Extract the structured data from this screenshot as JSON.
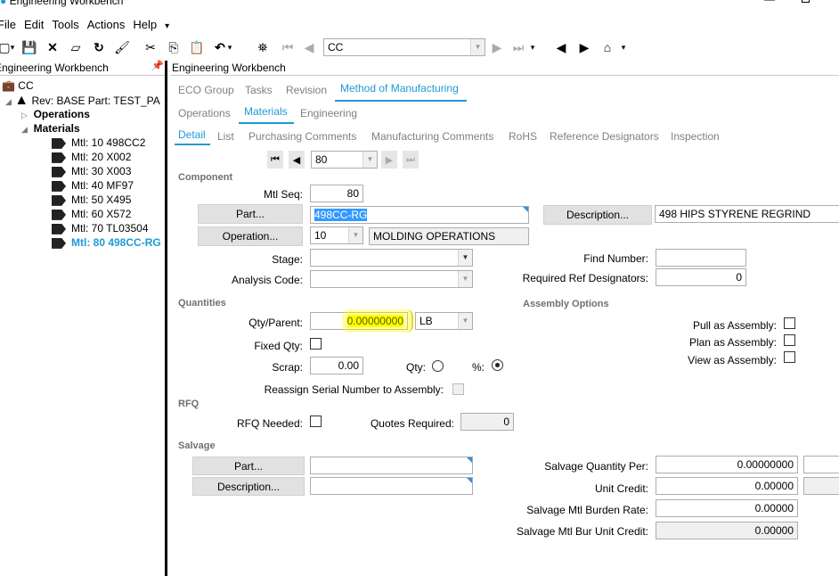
{
  "window": {
    "title": "Engineering Workbench"
  },
  "menu": [
    "File",
    "Edit",
    "Tools",
    "Actions",
    "Help"
  ],
  "toolbar": {
    "search_value": "CC"
  },
  "left": {
    "header": "Engineering Workbench",
    "root": "CC",
    "rev": "Rev: BASE Part: TEST_PA",
    "operations": "Operations",
    "materials": "Materials",
    "items": [
      "Mtl: 10 498CC2",
      "Mtl: 20 X002",
      "Mtl: 30 X003",
      "Mtl: 40 MF97",
      "Mtl: 50 X495",
      "Mtl: 60 X572",
      "Mtl: 70 TL03504",
      "Mtl: 80 498CC-RG"
    ]
  },
  "right": {
    "header": "Engineering Workbench"
  },
  "tabs1": [
    "ECO Group",
    "Tasks",
    "Revision",
    "Method of Manufacturing"
  ],
  "tabs2": [
    "Operations",
    "Materials",
    "Engineering"
  ],
  "tabs3": [
    "Detail",
    "List",
    "Purchasing Comments",
    "Manufacturing Comments",
    "RoHS",
    "Reference Designators",
    "Inspection"
  ],
  "nav_value": "80",
  "component": {
    "section": "Component",
    "mtl_seq_label": "Mtl Seq:",
    "mtl_seq": "80",
    "part_btn": "Part...",
    "part": "498CC-RG",
    "desc_btn": "Description...",
    "desc": "498 HIPS STYRENE REGRIND",
    "op_btn": "Operation...",
    "op_num": "10",
    "op_desc": "MOLDING OPERATIONS",
    "stage_label": "Stage:",
    "analysis_label": "Analysis Code:",
    "find_label": "Find Number:",
    "req_ref_label": "Required Ref Designators:",
    "req_ref": "0"
  },
  "quantities": {
    "section": "Quantities",
    "qty_parent_label": "Qty/Parent:",
    "qty_parent": "0.00000000",
    "uom": "LB",
    "fixed_label": "Fixed Qty:",
    "scrap_label": "Scrap:",
    "scrap": "0.00",
    "qty_radio": "Qty:",
    "pct_radio": "%:",
    "reassign_label": "Reassign Serial Number to Assembly:"
  },
  "assembly": {
    "section": "Assembly Options",
    "pull": "Pull as Assembly:",
    "plan": "Plan as Assembly:",
    "view": "View as Assembly:"
  },
  "rfq": {
    "section": "RFQ",
    "needed": "RFQ Needed:",
    "quotes_label": "Quotes Required:",
    "quotes": "0"
  },
  "salvage": {
    "section": "Salvage",
    "part_btn": "Part...",
    "desc_btn": "Description...",
    "qty_per_label": "Salvage Quantity Per:",
    "qty_per": "0.00000000",
    "unit_credit_label": "Unit Credit:",
    "unit_credit": "0.00000",
    "burden_label": "Salvage Mtl Burden Rate:",
    "burden": "0.00000",
    "bur_unit_label": "Salvage Mtl Bur Unit Credit:",
    "bur_unit": "0.00000"
  },
  "colors": {
    "accent": "#1e9ad6",
    "highlight": "#ffff00"
  }
}
